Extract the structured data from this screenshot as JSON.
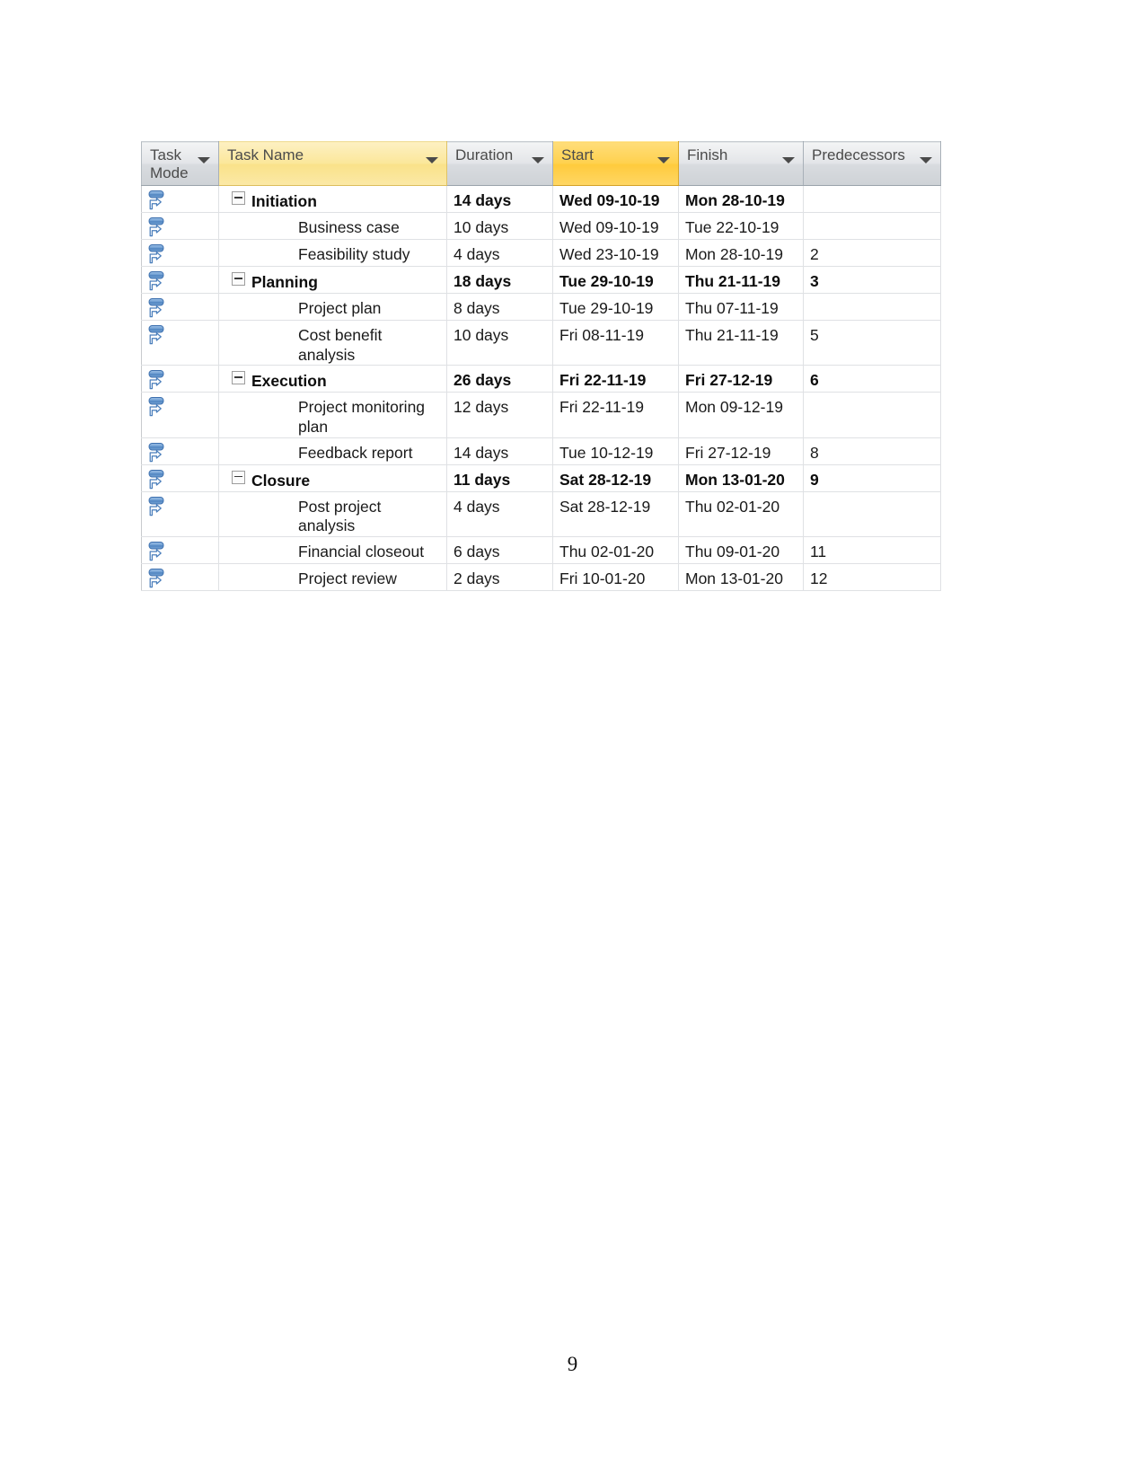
{
  "document": {
    "page_number": "9"
  },
  "table": {
    "columns": [
      {
        "key": "task_mode",
        "label": "Task\nMode",
        "icon": "chevron-down-icon",
        "highlight": "none"
      },
      {
        "key": "task_name",
        "label": "Task Name",
        "icon": "chevron-down-icon",
        "highlight": "light-yellow"
      },
      {
        "key": "duration",
        "label": "Duration",
        "icon": "chevron-down-icon",
        "highlight": "none"
      },
      {
        "key": "start",
        "label": "Start",
        "icon": "chevron-down-icon",
        "highlight": "gold"
      },
      {
        "key": "finish",
        "label": "Finish",
        "icon": "chevron-down-icon",
        "highlight": "none"
      },
      {
        "key": "predecessors",
        "label": "Predecessors",
        "icon": "chevron-down-icon",
        "highlight": "none"
      }
    ],
    "colors": {
      "header_gray": "#d8dbdf",
      "header_light_yellow": "#fae28a",
      "header_gold": "#ffcb3d",
      "gridline": "#dfe1e4",
      "task_mode_icon_blue": "#4a7ebb"
    },
    "rows": [
      {
        "task_mode_icon": "auto-scheduled-icon",
        "summary": true,
        "name": "Initiation",
        "duration": "14 days",
        "start": "Wed 09-10-19",
        "finish": "Mon 28-10-19",
        "predecessors": ""
      },
      {
        "task_mode_icon": "auto-scheduled-icon",
        "summary": false,
        "name": "Business case",
        "duration": "10 days",
        "start": "Wed 09-10-19",
        "finish": "Tue 22-10-19",
        "predecessors": ""
      },
      {
        "task_mode_icon": "auto-scheduled-icon",
        "summary": false,
        "name": "Feasibility study",
        "duration": "4 days",
        "start": "Wed 23-10-19",
        "finish": "Mon 28-10-19",
        "predecessors": "2"
      },
      {
        "task_mode_icon": "auto-scheduled-icon",
        "summary": true,
        "name": "Planning",
        "duration": "18 days",
        "start": "Tue 29-10-19",
        "finish": "Thu 21-11-19",
        "predecessors": "3"
      },
      {
        "task_mode_icon": "auto-scheduled-icon",
        "summary": false,
        "name": "Project plan",
        "duration": "8 days",
        "start": "Tue 29-10-19",
        "finish": "Thu 07-11-19",
        "predecessors": ""
      },
      {
        "task_mode_icon": "auto-scheduled-icon",
        "summary": false,
        "name": "Cost benefit analysis",
        "duration": "10 days",
        "start": "Fri 08-11-19",
        "finish": "Thu 21-11-19",
        "predecessors": "5"
      },
      {
        "task_mode_icon": "auto-scheduled-icon",
        "summary": true,
        "name": "Execution",
        "duration": "26 days",
        "start": "Fri 22-11-19",
        "finish": "Fri 27-12-19",
        "predecessors": "6"
      },
      {
        "task_mode_icon": "auto-scheduled-icon",
        "summary": false,
        "name": "Project monitoring plan",
        "duration": "12 days",
        "start": "Fri 22-11-19",
        "finish": "Mon 09-12-19",
        "predecessors": ""
      },
      {
        "task_mode_icon": "auto-scheduled-icon",
        "summary": false,
        "name": "Feedback report",
        "duration": "14 days",
        "start": "Tue 10-12-19",
        "finish": "Fri 27-12-19",
        "predecessors": "8"
      },
      {
        "task_mode_icon": "auto-scheduled-icon",
        "summary": true,
        "name": "Closure",
        "duration": "11 days",
        "start": "Sat 28-12-19",
        "finish": "Mon 13-01-20",
        "predecessors": "9"
      },
      {
        "task_mode_icon": "auto-scheduled-icon",
        "summary": false,
        "name": "Post project analysis",
        "duration": "4 days",
        "start": "Sat 28-12-19",
        "finish": "Thu 02-01-20",
        "predecessors": ""
      },
      {
        "task_mode_icon": "auto-scheduled-icon",
        "summary": false,
        "name": "Financial closeout",
        "duration": "6 days",
        "start": "Thu 02-01-20",
        "finish": "Thu 09-01-20",
        "predecessors": "11"
      },
      {
        "task_mode_icon": "auto-scheduled-icon",
        "summary": false,
        "name": "Project review",
        "duration": "2 days",
        "start": "Fri 10-01-20",
        "finish": "Mon 13-01-20",
        "predecessors": "12"
      }
    ]
  }
}
